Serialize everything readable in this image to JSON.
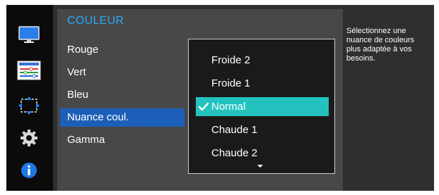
{
  "sidebar": {
    "icons": [
      "monitor-icon",
      "sliders-icon",
      "resize-arrows-icon",
      "gear-icon",
      "info-icon"
    ]
  },
  "menu": {
    "title": "COULEUR",
    "items": [
      {
        "label": "Rouge"
      },
      {
        "label": "Vert"
      },
      {
        "label": "Bleu"
      },
      {
        "label": "Nuance coul."
      },
      {
        "label": "Gamma"
      }
    ],
    "selected_index": 3
  },
  "dropdown": {
    "options": [
      {
        "label": "Froide 2"
      },
      {
        "label": "Froide 1"
      },
      {
        "label": "Normal"
      },
      {
        "label": "Chaude 1"
      },
      {
        "label": "Chaude 2"
      }
    ],
    "selected_index": 2,
    "check_icon": "checkmark-icon",
    "scroll_icon": "scroll-down-arrow-icon"
  },
  "help": {
    "text": "Sélectionnez une nuance de couleurs plus adaptée à vos besoins."
  },
  "colors": {
    "title_blue": "#2aa8f4",
    "menu_selected": "#1c5fb8",
    "option_selected": "#24c2be",
    "panel_bg": "#484848",
    "sidebar_bg": "#0b0b0b"
  }
}
